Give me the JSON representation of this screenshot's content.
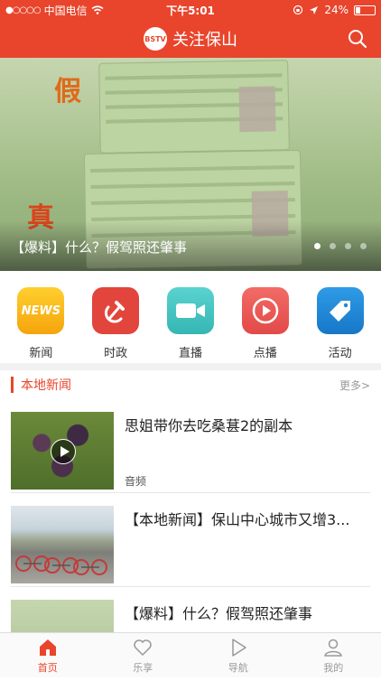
{
  "status_bar": {
    "carrier": "中国电信",
    "time": "下午5:01",
    "battery": "24%"
  },
  "nav": {
    "logo_text": "BSTV",
    "title": "关注保山",
    "search_icon": "search-icon"
  },
  "banner": {
    "fake_label": "假",
    "real_label": "真",
    "caption": "【爆料】什么？假驾照还肇事",
    "page_count": 4,
    "active_page": 1
  },
  "quick_links": [
    {
      "label": "新闻",
      "icon": "news-icon",
      "icon_text": "NEWS",
      "color": "#f7b21a"
    },
    {
      "label": "时政",
      "icon": "hammer-sickle-icon",
      "color": "#e2453c"
    },
    {
      "label": "直播",
      "icon": "video-camera-icon",
      "color": "#3ec2c0"
    },
    {
      "label": "点播",
      "icon": "play-circle-icon",
      "color": "#ee5a58"
    },
    {
      "label": "活动",
      "icon": "tag-icon",
      "color": "#1f86d8"
    }
  ],
  "section": {
    "title": "本地新闻",
    "more": "更多>"
  },
  "news_items": [
    {
      "headline": "思姐带你去吃桑葚2的副本",
      "tag": "音频"
    },
    {
      "headline": "【本地新闻】保山中心城市又增3...",
      "tag": ""
    },
    {
      "headline": "【爆料】什么？假驾照还肇事",
      "tag": ""
    }
  ],
  "tabs": [
    {
      "label": "首页",
      "icon": "home-icon",
      "active": true
    },
    {
      "label": "乐享",
      "icon": "heart-icon",
      "active": false
    },
    {
      "label": "导航",
      "icon": "play-triangle-icon",
      "active": false
    },
    {
      "label": "我的",
      "icon": "person-icon",
      "active": false
    }
  ],
  "colors": {
    "brand": "#e8452c"
  }
}
